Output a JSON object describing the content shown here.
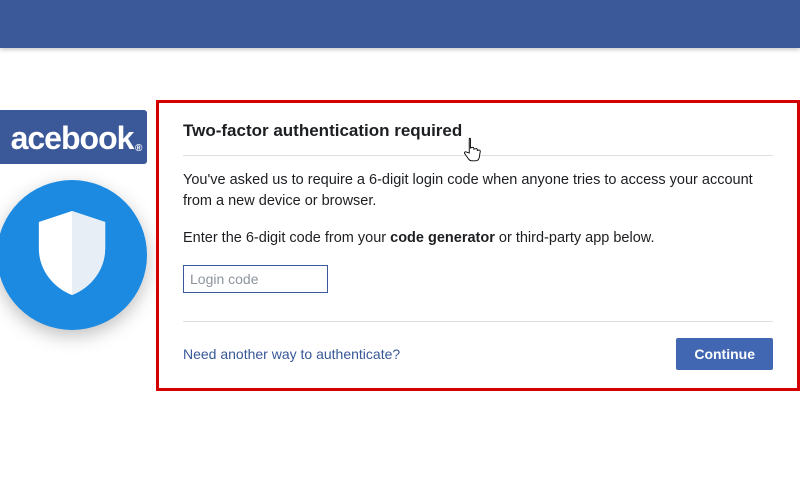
{
  "brand": {
    "logo_text": "acebook",
    "logo_dot": "®"
  },
  "dialog": {
    "title": "Two-factor authentication required",
    "body_line1": "You've asked us to require a 6-digit login code when anyone tries to access your account from a new device or browser.",
    "body_line2_prefix": "Enter the 6-digit code from your ",
    "body_line2_strong": "code generator",
    "body_line2_suffix": " or third-party app below.",
    "input_placeholder": "Login code",
    "input_value": "",
    "alt_link": "Need another way to authenticate?",
    "continue_label": "Continue"
  },
  "colors": {
    "fb_blue": "#3b5998",
    "shield_blue": "#1c8ae1",
    "highlight_red": "#d40000"
  }
}
